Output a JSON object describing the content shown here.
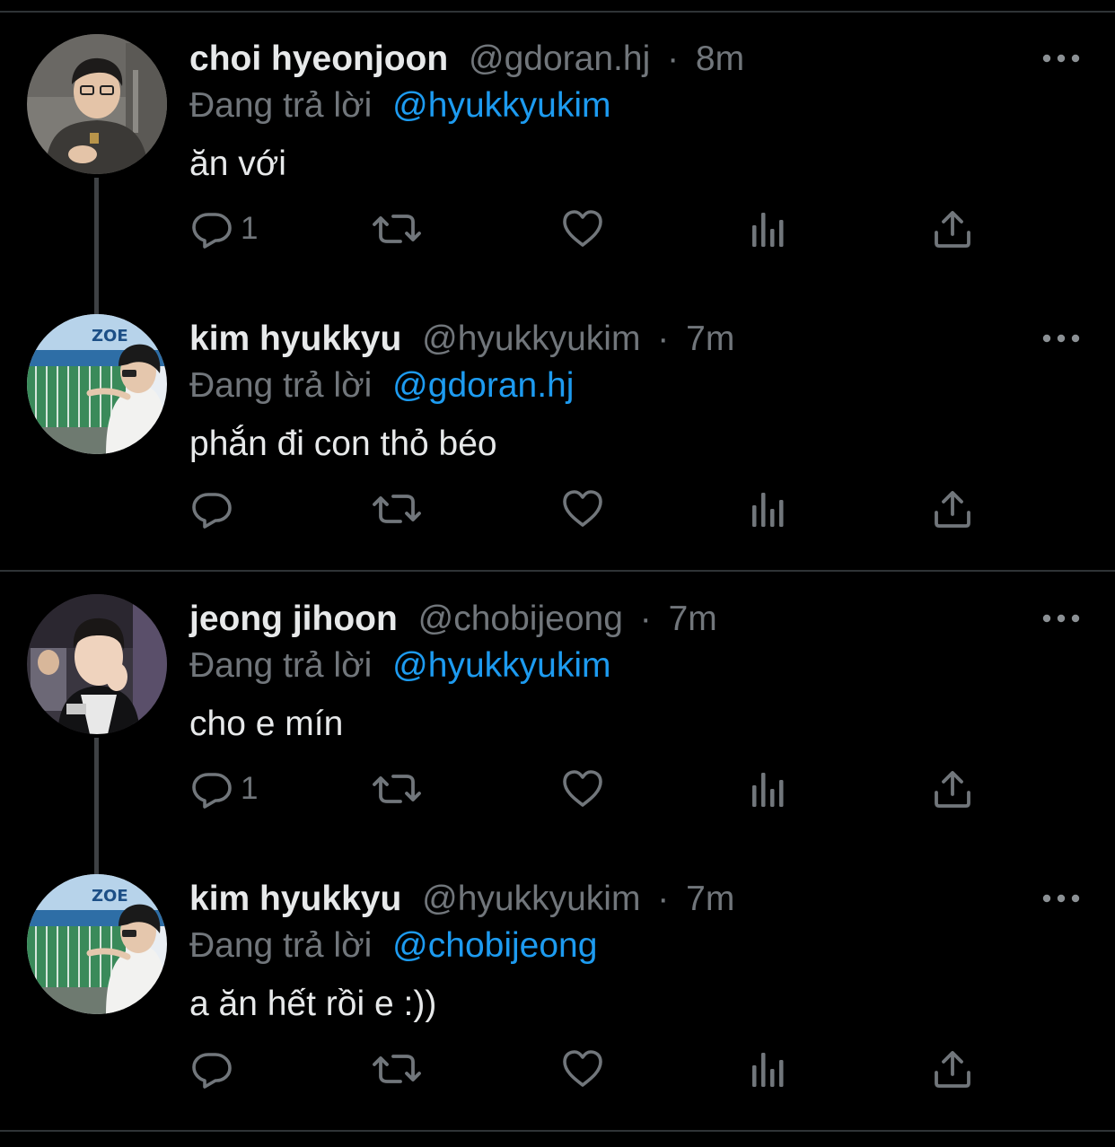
{
  "tweets": [
    {
      "display_name": "choi hyeonjoon",
      "handle": "@gdoran.hj",
      "separator": "·",
      "time": "8m",
      "reply_prefix": "Đang trả lời",
      "reply_to": "@hyukkyukim",
      "text": "ăn với",
      "reply_count": "1",
      "avatar": "avatar-choi"
    },
    {
      "display_name": "kim hyukkyu",
      "handle": "@hyukkyukim",
      "separator": "·",
      "time": "7m",
      "reply_prefix": "Đang trả lời",
      "reply_to": "@gdoran.hj",
      "text": "phắn đi con thỏ béo",
      "reply_count": "",
      "avatar": "avatar-kim"
    },
    {
      "display_name": "jeong jihoon",
      "handle": "@chobijeong",
      "separator": "·",
      "time": "7m",
      "reply_prefix": "Đang trả lời",
      "reply_to": "@hyukkyukim",
      "text": "cho e mín",
      "reply_count": "1",
      "avatar": "avatar-jeong"
    },
    {
      "display_name": "kim hyukkyu",
      "handle": "@hyukkyukim",
      "separator": "·",
      "time": "7m",
      "reply_prefix": "Đang trả lời",
      "reply_to": "@chobijeong",
      "text": "a ăn hết rồi e :))",
      "reply_count": "",
      "avatar": "avatar-kim"
    }
  ],
  "icons": {
    "reply": "reply-icon",
    "retweet": "retweet-icon",
    "like": "heart-icon",
    "views": "views-icon",
    "share": "share-icon",
    "more": "more-icon"
  },
  "colors": {
    "background": "#000000",
    "text": "#e7e9ea",
    "secondary": "#71767b",
    "link": "#1d9bf0",
    "divider": "#2f3336"
  }
}
